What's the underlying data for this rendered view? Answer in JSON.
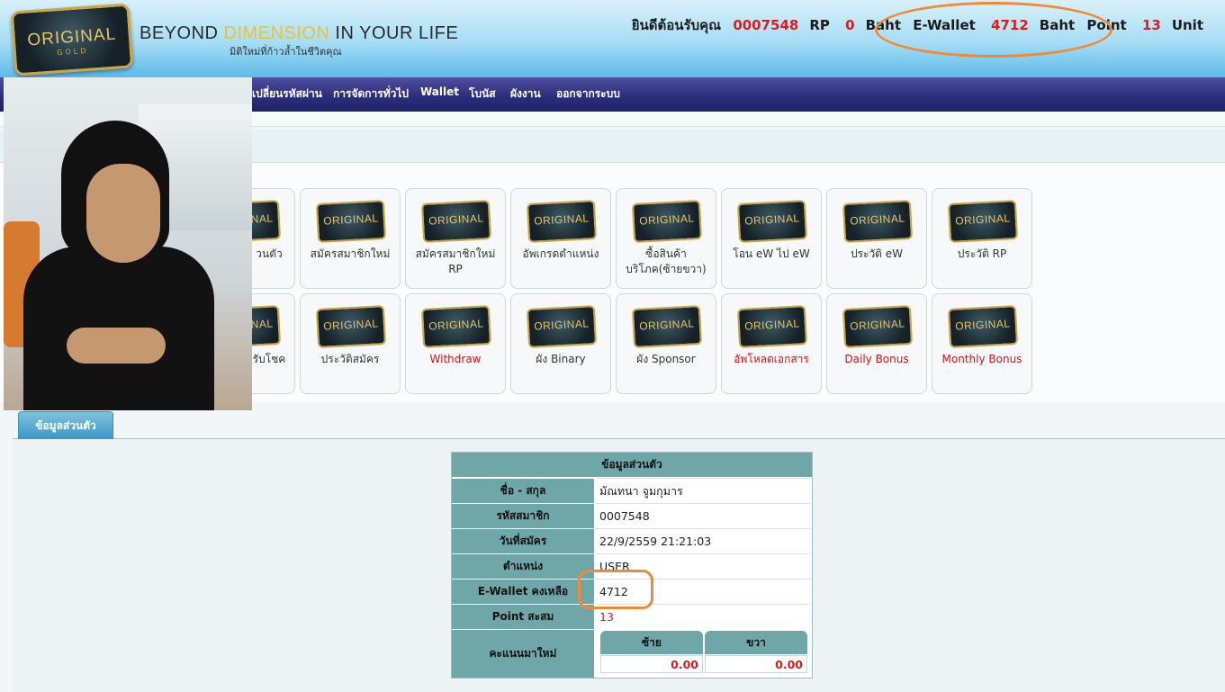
{
  "header": {
    "logo_text": "ORIGINAL",
    "logo_sub": "GOLD",
    "tagline_pre": "BEYOND ",
    "tagline_hl": "DIMENSION",
    "tagline_post": " IN YOUR LIFE",
    "tagline_sub": "มิติใหม่ที่ก้าวล้ำในชีวิตคุณ",
    "welcome_label": "ยินดีต้อนรับคุณ",
    "member_id": "0007548",
    "rp_label": "RP",
    "rp_value": "0",
    "baht_label1": "Baht",
    "ewallet_label": "E-Wallet",
    "ewallet_value": "4712",
    "baht_label2": "Baht",
    "point_label": "Point",
    "point_value": "13",
    "unit_label": "Unit"
  },
  "nav": {
    "items": [
      "เปลี่ยนรหัสผ่าน",
      "การจัดการทั่วไป",
      "Wallet",
      "โบนัส",
      "ผังงาน",
      "ออกจากระบบ"
    ]
  },
  "tiles": {
    "icon_text": "ORIGINAL",
    "row1": [
      "วนตัว",
      "สมัครสมาชิกใหม่",
      "สมัครสมาชิกใหม่ RP",
      "อัพเกรดตำแหน่ง",
      "ซื้อสินค้าบริโภค(ซ้ายขวา)",
      "โอน eW ไป eW",
      "ประวัติ eW",
      "ประวัติ RP"
    ],
    "row2": [
      "รับโชค",
      "ประวัติสมัคร",
      "Withdraw",
      "ผัง Binary",
      "ผัง Sponsor",
      "อัพโหลดเอกสาร",
      "Daily Bonus",
      "Monthly Bonus"
    ]
  },
  "tab": {
    "label": "ข้อมูลส่วนตัว"
  },
  "profile": {
    "title": "ข้อมูลส่วนตัว",
    "rows": [
      {
        "label": "ชื่อ - สกุล",
        "value": "มัณทนา จูมกุมาร"
      },
      {
        "label": "รหัสสมาชิก",
        "value": "0007548"
      },
      {
        "label": "วันที่สมัคร",
        "value": "22/9/2559 21:21:03"
      },
      {
        "label": "ตำแหน่ง",
        "value": "USER"
      },
      {
        "label": "E-Wallet คงเหลือ",
        "value": "4712"
      },
      {
        "label": "Point สะสม",
        "value": "13"
      }
    ],
    "score_label": "คะแนนมาใหม่",
    "left_label": "ซ้าย",
    "right_label": "ขวา",
    "left_value": "0.00",
    "right_value": "0.00"
  }
}
